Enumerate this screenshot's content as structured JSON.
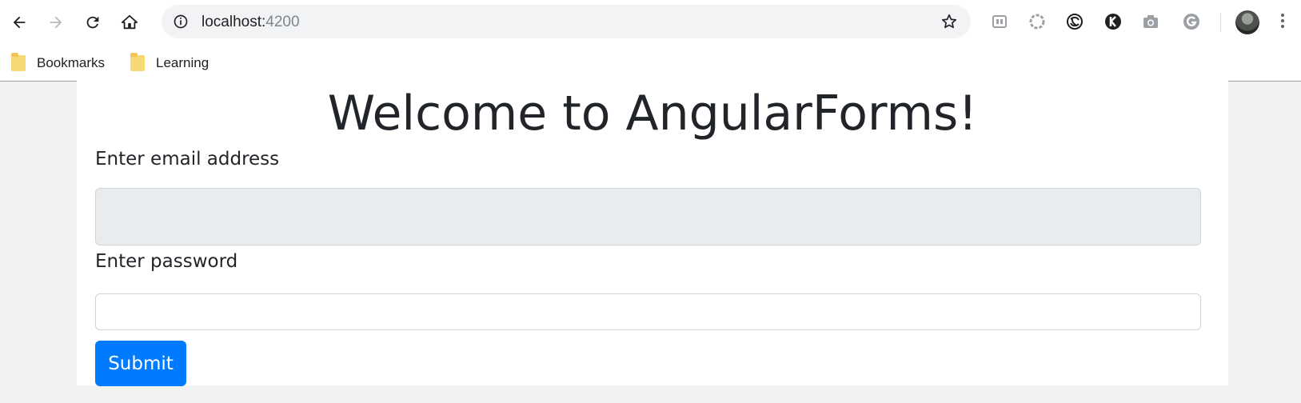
{
  "browser": {
    "url_host": "localhost:",
    "url_port": "4200",
    "bookmarks": [
      {
        "label": "Bookmarks"
      },
      {
        "label": "Learning"
      }
    ]
  },
  "page": {
    "title": "Welcome to AngularForms!",
    "email_label": "Enter email address",
    "email_value": "",
    "password_label": "Enter password",
    "password_value": "",
    "submit_label": "Submit"
  },
  "colors": {
    "primary": "#007bff",
    "disabled_input_bg": "#e9ecef",
    "text": "#212529"
  }
}
